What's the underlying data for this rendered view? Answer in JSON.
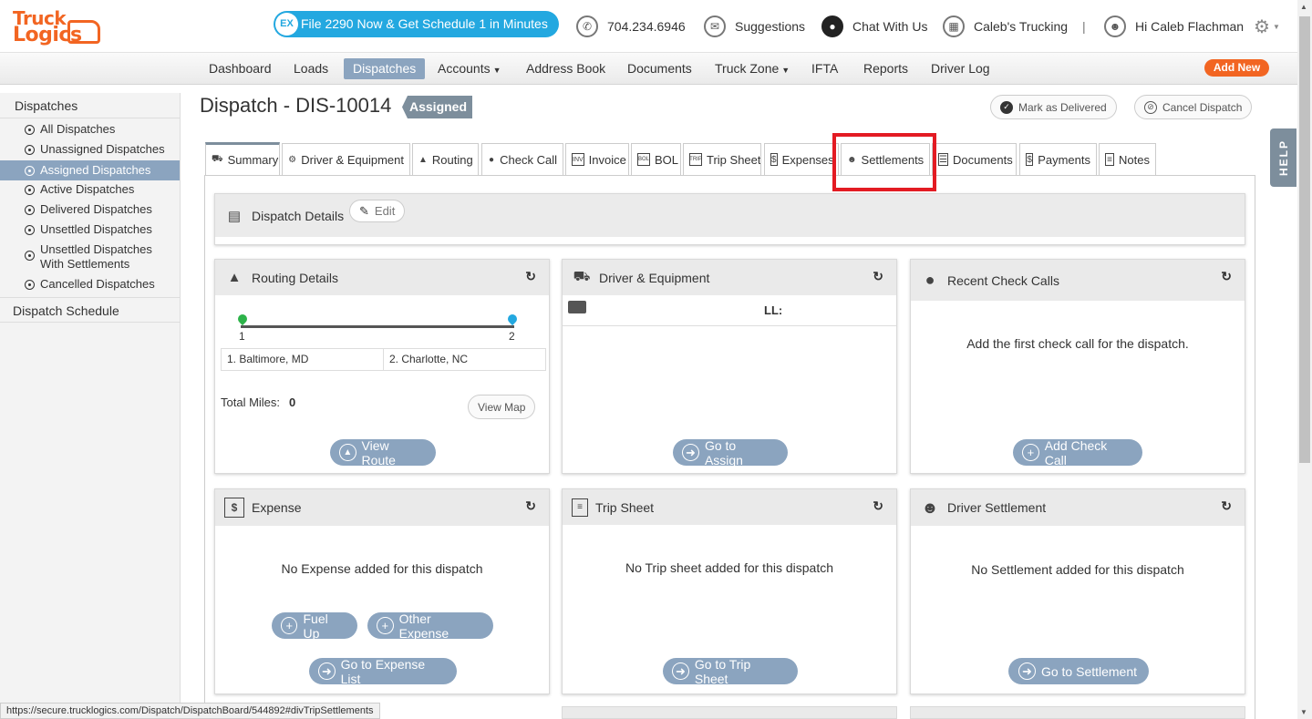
{
  "header": {
    "logo_line1": "Truck",
    "logo_line2": "Logics",
    "promo_badge": "EX",
    "promo_text": "File 2290 Now & Get Schedule 1 in Minutes",
    "phone": "704.234.6946",
    "suggestions": "Suggestions",
    "chat": "Chat With Us",
    "company": "Caleb's Trucking",
    "separator": "|",
    "greeting": "Hi Caleb Flachman"
  },
  "nav": {
    "items": [
      {
        "label": "Dashboard"
      },
      {
        "label": "Loads"
      },
      {
        "label": "Dispatches"
      },
      {
        "label": "Accounts"
      },
      {
        "label": "Address Book"
      },
      {
        "label": "Documents"
      },
      {
        "label": "Truck Zone"
      },
      {
        "label": "IFTA"
      },
      {
        "label": "Reports"
      },
      {
        "label": "Driver Log"
      }
    ],
    "add_new": "Add New"
  },
  "sidebar": {
    "section_title": "Dispatches",
    "items": [
      {
        "label": "All Dispatches"
      },
      {
        "label": "Unassigned Dispatches"
      },
      {
        "label": "Assigned Dispatches"
      },
      {
        "label": "Active Dispatches"
      },
      {
        "label": "Delivered Dispatches"
      },
      {
        "label": "Unsettled Dispatches"
      },
      {
        "label": "Unsettled Dispatches With Settlements"
      },
      {
        "label": "Cancelled Dispatches"
      }
    ],
    "schedule": "Dispatch Schedule"
  },
  "page": {
    "title": "Dispatch - DIS-10014",
    "status": "Assigned",
    "mark_delivered": "Mark as Delivered",
    "cancel_dispatch": "Cancel Dispatch",
    "help": "HELP"
  },
  "tabs": [
    {
      "label": "Summary"
    },
    {
      "label": "Driver & Equipment"
    },
    {
      "label": "Routing"
    },
    {
      "label": "Check Call"
    },
    {
      "label": "Invoice"
    },
    {
      "label": "BOL"
    },
    {
      "label": "Trip Sheet"
    },
    {
      "label": "Expenses"
    },
    {
      "label": "Settlements"
    },
    {
      "label": "Documents"
    },
    {
      "label": "Payments"
    },
    {
      "label": "Notes"
    }
  ],
  "dispatch_details": {
    "title": "Dispatch Details",
    "edit": "Edit"
  },
  "routing": {
    "title": "Routing Details",
    "stop1_num": "1",
    "stop2_num": "2",
    "stop1": "1. Baltimore, MD",
    "stop2": "2. Charlotte, NC",
    "total_miles_label": "Total Miles:",
    "total_miles": "0",
    "view_map": "View Map",
    "view_route": "View Route"
  },
  "driver_equipment": {
    "title": "Driver & Equipment",
    "ll": "LL:",
    "go_assign": "Go to Assign"
  },
  "check_calls": {
    "title": "Recent Check Calls",
    "empty": "Add the first check call for the dispatch.",
    "add": "Add Check Call"
  },
  "expense": {
    "title": "Expense",
    "empty": "No Expense added for this dispatch",
    "fuel_up": "Fuel Up",
    "other_expense": "Other Expense",
    "go_list": "Go to Expense List"
  },
  "trip_sheet": {
    "title": "Trip Sheet",
    "empty": "No Trip sheet added for this dispatch",
    "go": "Go to Trip Sheet"
  },
  "settlement": {
    "title": "Driver Settlement",
    "empty": "No Settlement added for this dispatch",
    "go": "Go to Settlement"
  },
  "status_url": "https://secure.trucklogics.com/Dispatch/DispatchBoard/544892#divTripSettlements",
  "colors": {
    "brand_orange": "#f26522",
    "promo_blue": "#23a8e0",
    "accent_slate": "#8ba4bf",
    "highlight_red": "#e31b23"
  }
}
